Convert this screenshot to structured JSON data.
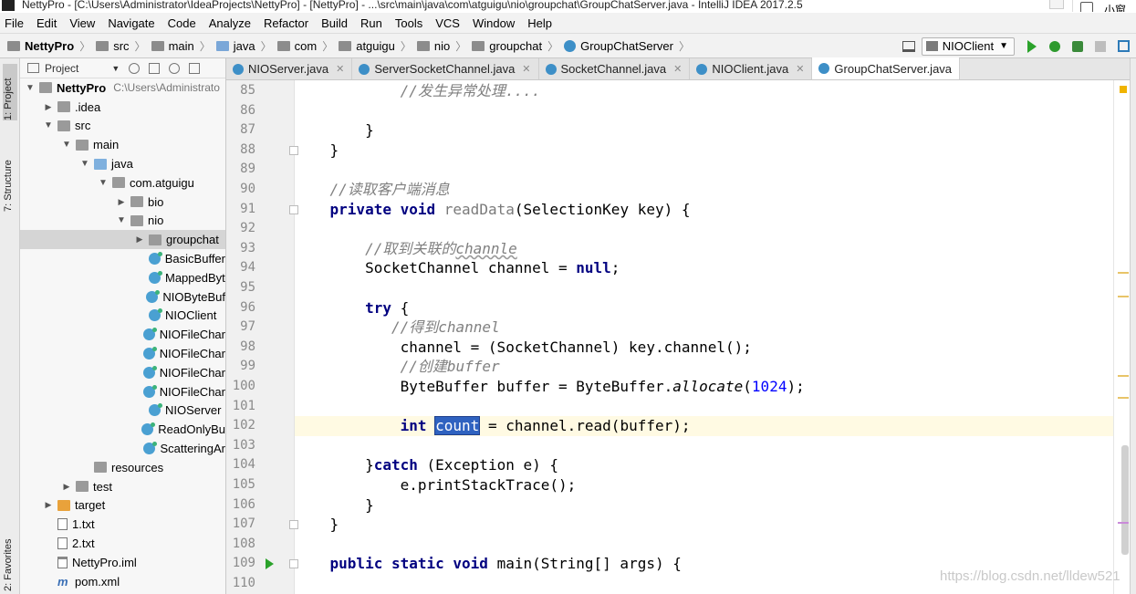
{
  "window": {
    "title": "NettyPro - [C:\\Users\\Administrator\\IdeaProjects\\NettyPro] - [NettyPro] - ...\\src\\main\\java\\com\\atguigu\\nio\\groupchat\\GroupChatServer.java - IntelliJ IDEA 2017.2.5",
    "ime_label": "小窗口"
  },
  "menu": [
    "File",
    "Edit",
    "View",
    "Navigate",
    "Code",
    "Analyze",
    "Refactor",
    "Build",
    "Run",
    "Tools",
    "VCS",
    "Window",
    "Help"
  ],
  "breadcrumbs": [
    "NettyPro",
    "src",
    "main",
    "java",
    "com",
    "atguigu",
    "nio",
    "groupchat",
    "GroupChatServer"
  ],
  "run_config": "NIOClient",
  "left_tabs": {
    "project": "1: Project",
    "structure": "7: Structure",
    "favorites": "2: Favorites"
  },
  "project_panel": {
    "header": "Project",
    "tree": [
      {
        "label": "NettyPro",
        "path": "C:\\Users\\Administrato",
        "icon": "folder",
        "depth": 0,
        "arrow": "down",
        "bold": true
      },
      {
        "label": ".idea",
        "icon": "folder",
        "depth": 1,
        "arrow": "right"
      },
      {
        "label": "src",
        "icon": "folder",
        "depth": 1,
        "arrow": "down"
      },
      {
        "label": "main",
        "icon": "folder",
        "depth": 2,
        "arrow": "down"
      },
      {
        "label": "java",
        "icon": "folder-blue",
        "depth": 3,
        "arrow": "down"
      },
      {
        "label": "com.atguigu",
        "icon": "pkg",
        "depth": 4,
        "arrow": "down"
      },
      {
        "label": "bio",
        "icon": "pkg",
        "depth": 5,
        "arrow": "right"
      },
      {
        "label": "nio",
        "icon": "pkg",
        "depth": 5,
        "arrow": "down"
      },
      {
        "label": "groupchat",
        "icon": "pkg",
        "depth": 6,
        "arrow": "right",
        "selected": true
      },
      {
        "label": "BasicBuffer",
        "icon": "cls",
        "depth": 6
      },
      {
        "label": "MappedByt",
        "icon": "cls",
        "depth": 6
      },
      {
        "label": "NIOByteBuf",
        "icon": "cls",
        "depth": 6
      },
      {
        "label": "NIOClient",
        "icon": "cls",
        "depth": 6
      },
      {
        "label": "NIOFileChar",
        "icon": "cls",
        "depth": 6
      },
      {
        "label": "NIOFileChar",
        "icon": "cls",
        "depth": 6
      },
      {
        "label": "NIOFileChar",
        "icon": "cls",
        "depth": 6
      },
      {
        "label": "NIOFileChar",
        "icon": "cls",
        "depth": 6
      },
      {
        "label": "NIOServer",
        "icon": "cls",
        "depth": 6
      },
      {
        "label": "ReadOnlyBu",
        "icon": "cls",
        "depth": 6
      },
      {
        "label": "ScatteringAr",
        "icon": "cls",
        "depth": 6
      },
      {
        "label": "resources",
        "icon": "folder",
        "depth": 3
      },
      {
        "label": "test",
        "icon": "folder",
        "depth": 2,
        "arrow": "right"
      },
      {
        "label": "target",
        "icon": "folder-orange",
        "depth": 1,
        "arrow": "right"
      },
      {
        "label": "1.txt",
        "icon": "txt",
        "depth": 1
      },
      {
        "label": "2.txt",
        "icon": "txt",
        "depth": 1
      },
      {
        "label": "NettyPro.iml",
        "icon": "iml",
        "depth": 1
      },
      {
        "label": "pom.xml",
        "icon": "mvn",
        "depth": 1
      }
    ]
  },
  "tabs": [
    {
      "label": "NIOServer.java",
      "active": false
    },
    {
      "label": "ServerSocketChannel.java",
      "active": false
    },
    {
      "label": "SocketChannel.java",
      "active": false
    },
    {
      "label": "NIOClient.java",
      "active": false
    },
    {
      "label": "GroupChatServer.java",
      "active": true
    }
  ],
  "editor": {
    "current_line": 102,
    "lines": [
      {
        "n": 85,
        "tokens": [
          {
            "t": "            "
          },
          {
            "t": "//发生异常处理....",
            "c": "cm"
          }
        ]
      },
      {
        "n": 86,
        "tokens": []
      },
      {
        "n": 87,
        "tokens": [
          {
            "t": "        }"
          }
        ]
      },
      {
        "n": 88,
        "tokens": [
          {
            "t": "    }"
          }
        ],
        "fold": true
      },
      {
        "n": 89,
        "tokens": []
      },
      {
        "n": 90,
        "tokens": [
          {
            "t": "    "
          },
          {
            "t": "//读取客户端消息",
            "c": "cm"
          }
        ]
      },
      {
        "n": 91,
        "tokens": [
          {
            "t": "    "
          },
          {
            "t": "private",
            "c": "kw"
          },
          {
            "t": " "
          },
          {
            "t": "void",
            "c": "kw"
          },
          {
            "t": " "
          },
          {
            "t": "readData",
            "c": "fn-unused"
          },
          {
            "t": "(SelectionKey key) {"
          }
        ],
        "fold": true
      },
      {
        "n": 92,
        "tokens": []
      },
      {
        "n": 93,
        "tokens": [
          {
            "t": "        "
          },
          {
            "t": "//取到关联的",
            "c": "cm"
          },
          {
            "t": "channle",
            "c": "cm wavy"
          }
        ]
      },
      {
        "n": 94,
        "tokens": [
          {
            "t": "        SocketChannel channel = "
          },
          {
            "t": "null",
            "c": "kw"
          },
          {
            "t": ";"
          }
        ]
      },
      {
        "n": 95,
        "tokens": []
      },
      {
        "n": 96,
        "tokens": [
          {
            "t": "        "
          },
          {
            "t": "try",
            "c": "kw"
          },
          {
            "t": " {"
          }
        ]
      },
      {
        "n": 97,
        "tokens": [
          {
            "t": "           "
          },
          {
            "t": "//得到channel",
            "c": "cm"
          }
        ]
      },
      {
        "n": 98,
        "tokens": [
          {
            "t": "            channel = (SocketChannel) key.channel();"
          }
        ]
      },
      {
        "n": 99,
        "tokens": [
          {
            "t": "            "
          },
          {
            "t": "//创建buffer",
            "c": "cm"
          }
        ]
      },
      {
        "n": 100,
        "tokens": [
          {
            "t": "            ByteBuffer buffer = ByteBuffer."
          },
          {
            "t": "allocate",
            "c": "it"
          },
          {
            "t": "("
          },
          {
            "t": "1024",
            "c": "num"
          },
          {
            "t": ");"
          }
        ]
      },
      {
        "n": 101,
        "tokens": []
      },
      {
        "n": 102,
        "tokens": [
          {
            "t": "            "
          },
          {
            "t": "int",
            "c": "kw"
          },
          {
            "t": " "
          },
          {
            "t": "count",
            "c": "sel"
          },
          {
            "t": " = channel.read(buffer);"
          }
        ],
        "bulb": true
      },
      {
        "n": 103,
        "tokens": []
      },
      {
        "n": 104,
        "tokens": [
          {
            "t": "        }"
          },
          {
            "t": "catch",
            "c": "kw"
          },
          {
            "t": " (Exception e) {"
          }
        ]
      },
      {
        "n": 105,
        "tokens": [
          {
            "t": "            e.printStackTrace();"
          }
        ]
      },
      {
        "n": 106,
        "tokens": [
          {
            "t": "        }"
          }
        ]
      },
      {
        "n": 107,
        "tokens": [
          {
            "t": "    }"
          }
        ],
        "fold": true
      },
      {
        "n": 108,
        "tokens": []
      },
      {
        "n": 109,
        "tokens": [
          {
            "t": "    "
          },
          {
            "t": "public",
            "c": "kw"
          },
          {
            "t": " "
          },
          {
            "t": "static",
            "c": "kw"
          },
          {
            "t": " "
          },
          {
            "t": "void",
            "c": "kw"
          },
          {
            "t": " main(String[] args) {"
          }
        ],
        "run": true,
        "fold": true
      },
      {
        "n": 110,
        "tokens": []
      }
    ]
  },
  "watermark": "https://blog.csdn.net/lldew521"
}
